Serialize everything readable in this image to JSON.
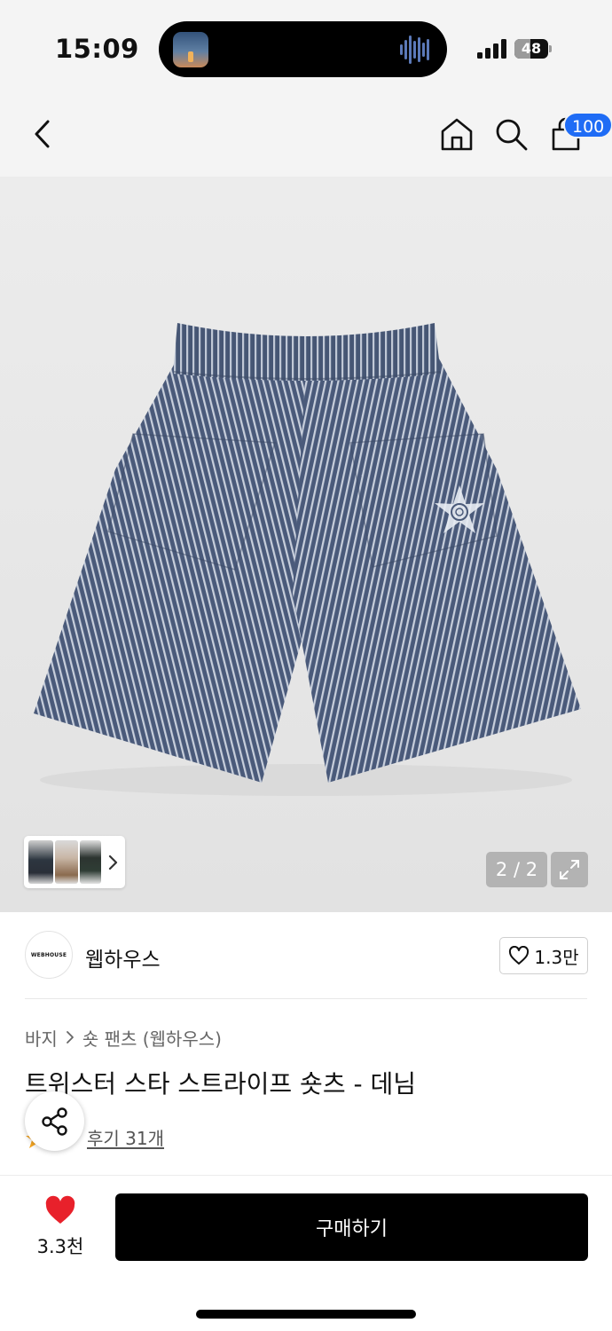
{
  "status_bar": {
    "time": "15:09",
    "battery_level": 48,
    "battery_text": "48",
    "icons": [
      "now-playing-art-icon",
      "audio-waveform-icon",
      "cellular-signal-icon",
      "battery-icon"
    ]
  },
  "nav": {
    "icons": [
      "back-chevron-icon",
      "home-icon",
      "search-icon",
      "shopping-bag-icon"
    ],
    "cart_badge": "100"
  },
  "gallery": {
    "page_counter": "2 / 2",
    "icons": [
      "chevron-right-icon",
      "expand-icon"
    ]
  },
  "brand": {
    "logo_text": "WEBHOUSE",
    "name": "웹하우스",
    "like_count": "1.3만"
  },
  "product": {
    "breadcrumb": [
      "바지",
      "숏 팬츠 (웹하우스)"
    ],
    "title": "트위스터 스타 스트라이프 숏츠 - 데님",
    "review_link": "후기 31개"
  },
  "bottom_bar": {
    "wish_count": "3.3천",
    "buy_label": "구매하기"
  },
  "colors": {
    "badge": "#1f6cf5",
    "wish_heart": "#e8212b",
    "buy_button": "#000000",
    "rating_star": "#f5a623"
  }
}
